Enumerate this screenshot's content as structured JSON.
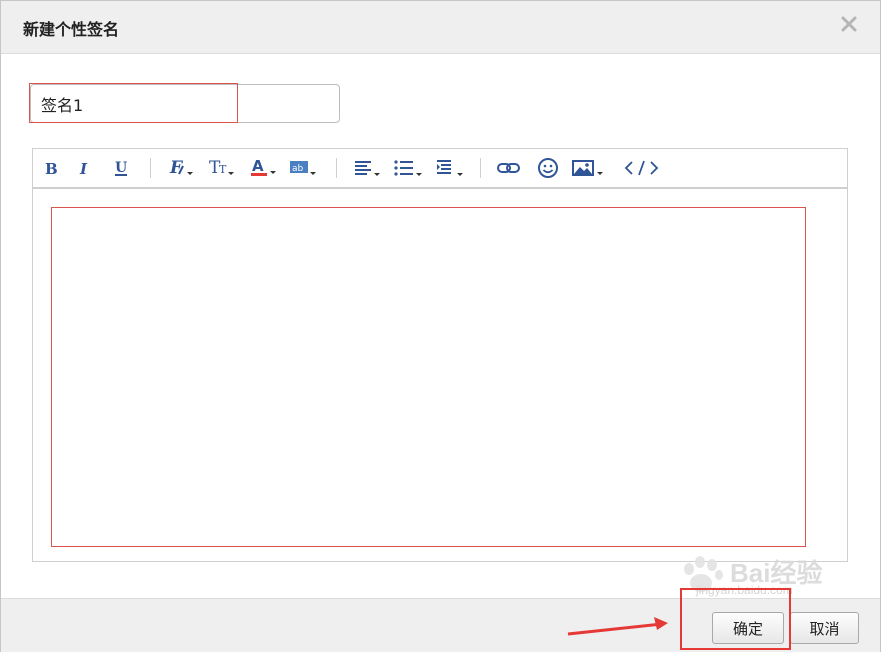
{
  "dialog": {
    "title": "新建个性签名",
    "close_icon": "close-icon"
  },
  "signature_name": {
    "value": "签名1"
  },
  "toolbar": {
    "items": [
      {
        "name": "bold-icon"
      },
      {
        "name": "italic-icon"
      },
      {
        "name": "underline-icon"
      },
      {
        "name": "font-family-icon"
      },
      {
        "name": "font-size-icon"
      },
      {
        "name": "font-color-icon"
      },
      {
        "name": "highlight-color-icon"
      },
      {
        "name": "align-icon"
      },
      {
        "name": "bullet-list-icon"
      },
      {
        "name": "indent-icon"
      },
      {
        "name": "link-icon"
      },
      {
        "name": "emoji-icon"
      },
      {
        "name": "image-icon"
      },
      {
        "name": "source-code-icon"
      }
    ]
  },
  "editor": {
    "content": ""
  },
  "footer": {
    "ok_label": "确定",
    "cancel_label": "取消"
  },
  "watermark": {
    "brand": "Bai经验",
    "url": "jingyan.baidu.com"
  },
  "colors": {
    "highlight": "#e53935",
    "toolbar_icon": "#2f5597",
    "chrome": "#efefef"
  }
}
